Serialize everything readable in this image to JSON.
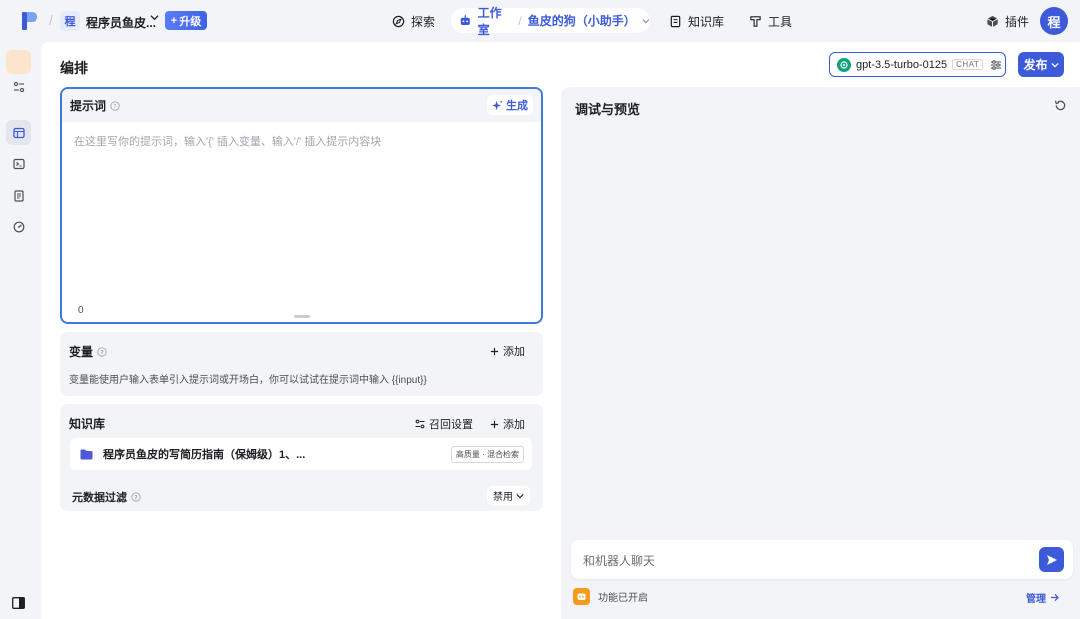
{
  "topbar": {
    "workspace_initial": "程",
    "workspace_name": "程序员鱼皮...",
    "upgrade_label": "升级",
    "nav_explore": "探索",
    "nav_studio": "工作室",
    "bot_name": "鱼皮的狗（小助手）",
    "nav_knowledge": "知识库",
    "nav_tools": "工具",
    "nav_plugins": "插件",
    "user_initial": "程"
  },
  "editor": {
    "title": "编排",
    "model_name": "gpt-3.5-turbo-0125",
    "model_tag": "CHAT",
    "publish_label": "发布"
  },
  "prompt": {
    "title": "提示词",
    "generate_label": "生成",
    "placeholder": "在这里写你的提示词，输入'{' 插入变量、输入'/' 插入提示内容块",
    "char_count": "0"
  },
  "variables": {
    "title": "变量",
    "add_label": "添加",
    "description": "变量能使用户输入表单引入提示词或开场白，你可以试试在提示词中输入 {{input}}"
  },
  "knowledge": {
    "title": "知识库",
    "recall_label": "召回设置",
    "add_label": "添加",
    "item_name": "程序员鱼皮的写简历指南（保姆级）1、...",
    "item_tag": "高质量 · 混合检索",
    "meta_filter_title": "元数据过滤",
    "meta_filter_value": "禁用"
  },
  "preview": {
    "title": "调试与预览",
    "chat_placeholder": "和机器人聊天",
    "feature_text": "功能已开启",
    "manage_label": "管理"
  },
  "colors": {
    "accent": "#3d5bd9",
    "feature": "#f59b1b",
    "gpt": "#10a37f"
  }
}
